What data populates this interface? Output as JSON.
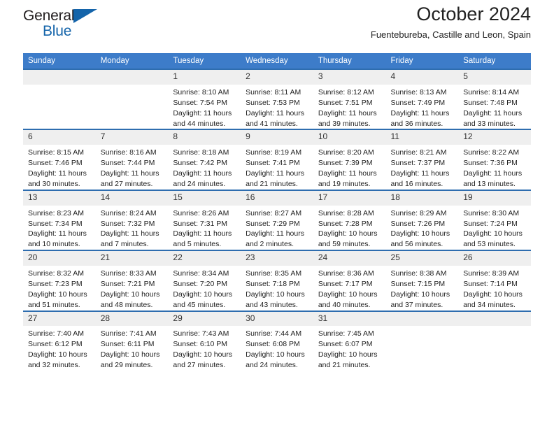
{
  "brand": {
    "name_part1": "General",
    "name_part2": "Blue",
    "accent_color": "#1464aa"
  },
  "header": {
    "title": "October 2024",
    "subtitle": "Fuentebureba, Castille and Leon, Spain"
  },
  "calendar": {
    "header_bg": "#3d7cc9",
    "row_border_color": "#2e6daf",
    "daynum_bg": "#efefef",
    "weekdays": [
      "Sunday",
      "Monday",
      "Tuesday",
      "Wednesday",
      "Thursday",
      "Friday",
      "Saturday"
    ],
    "weeks": [
      [
        {
          "day": "",
          "lines": []
        },
        {
          "day": "",
          "lines": []
        },
        {
          "day": "1",
          "lines": [
            "Sunrise: 8:10 AM",
            "Sunset: 7:54 PM",
            "Daylight: 11 hours and 44 minutes."
          ]
        },
        {
          "day": "2",
          "lines": [
            "Sunrise: 8:11 AM",
            "Sunset: 7:53 PM",
            "Daylight: 11 hours and 41 minutes."
          ]
        },
        {
          "day": "3",
          "lines": [
            "Sunrise: 8:12 AM",
            "Sunset: 7:51 PM",
            "Daylight: 11 hours and 39 minutes."
          ]
        },
        {
          "day": "4",
          "lines": [
            "Sunrise: 8:13 AM",
            "Sunset: 7:49 PM",
            "Daylight: 11 hours and 36 minutes."
          ]
        },
        {
          "day": "5",
          "lines": [
            "Sunrise: 8:14 AM",
            "Sunset: 7:48 PM",
            "Daylight: 11 hours and 33 minutes."
          ]
        }
      ],
      [
        {
          "day": "6",
          "lines": [
            "Sunrise: 8:15 AM",
            "Sunset: 7:46 PM",
            "Daylight: 11 hours and 30 minutes."
          ]
        },
        {
          "day": "7",
          "lines": [
            "Sunrise: 8:16 AM",
            "Sunset: 7:44 PM",
            "Daylight: 11 hours and 27 minutes."
          ]
        },
        {
          "day": "8",
          "lines": [
            "Sunrise: 8:18 AM",
            "Sunset: 7:42 PM",
            "Daylight: 11 hours and 24 minutes."
          ]
        },
        {
          "day": "9",
          "lines": [
            "Sunrise: 8:19 AM",
            "Sunset: 7:41 PM",
            "Daylight: 11 hours and 21 minutes."
          ]
        },
        {
          "day": "10",
          "lines": [
            "Sunrise: 8:20 AM",
            "Sunset: 7:39 PM",
            "Daylight: 11 hours and 19 minutes."
          ]
        },
        {
          "day": "11",
          "lines": [
            "Sunrise: 8:21 AM",
            "Sunset: 7:37 PM",
            "Daylight: 11 hours and 16 minutes."
          ]
        },
        {
          "day": "12",
          "lines": [
            "Sunrise: 8:22 AM",
            "Sunset: 7:36 PM",
            "Daylight: 11 hours and 13 minutes."
          ]
        }
      ],
      [
        {
          "day": "13",
          "lines": [
            "Sunrise: 8:23 AM",
            "Sunset: 7:34 PM",
            "Daylight: 11 hours and 10 minutes."
          ]
        },
        {
          "day": "14",
          "lines": [
            "Sunrise: 8:24 AM",
            "Sunset: 7:32 PM",
            "Daylight: 11 hours and 7 minutes."
          ]
        },
        {
          "day": "15",
          "lines": [
            "Sunrise: 8:26 AM",
            "Sunset: 7:31 PM",
            "Daylight: 11 hours and 5 minutes."
          ]
        },
        {
          "day": "16",
          "lines": [
            "Sunrise: 8:27 AM",
            "Sunset: 7:29 PM",
            "Daylight: 11 hours and 2 minutes."
          ]
        },
        {
          "day": "17",
          "lines": [
            "Sunrise: 8:28 AM",
            "Sunset: 7:28 PM",
            "Daylight: 10 hours and 59 minutes."
          ]
        },
        {
          "day": "18",
          "lines": [
            "Sunrise: 8:29 AM",
            "Sunset: 7:26 PM",
            "Daylight: 10 hours and 56 minutes."
          ]
        },
        {
          "day": "19",
          "lines": [
            "Sunrise: 8:30 AM",
            "Sunset: 7:24 PM",
            "Daylight: 10 hours and 53 minutes."
          ]
        }
      ],
      [
        {
          "day": "20",
          "lines": [
            "Sunrise: 8:32 AM",
            "Sunset: 7:23 PM",
            "Daylight: 10 hours and 51 minutes."
          ]
        },
        {
          "day": "21",
          "lines": [
            "Sunrise: 8:33 AM",
            "Sunset: 7:21 PM",
            "Daylight: 10 hours and 48 minutes."
          ]
        },
        {
          "day": "22",
          "lines": [
            "Sunrise: 8:34 AM",
            "Sunset: 7:20 PM",
            "Daylight: 10 hours and 45 minutes."
          ]
        },
        {
          "day": "23",
          "lines": [
            "Sunrise: 8:35 AM",
            "Sunset: 7:18 PM",
            "Daylight: 10 hours and 43 minutes."
          ]
        },
        {
          "day": "24",
          "lines": [
            "Sunrise: 8:36 AM",
            "Sunset: 7:17 PM",
            "Daylight: 10 hours and 40 minutes."
          ]
        },
        {
          "day": "25",
          "lines": [
            "Sunrise: 8:38 AM",
            "Sunset: 7:15 PM",
            "Daylight: 10 hours and 37 minutes."
          ]
        },
        {
          "day": "26",
          "lines": [
            "Sunrise: 8:39 AM",
            "Sunset: 7:14 PM",
            "Daylight: 10 hours and 34 minutes."
          ]
        }
      ],
      [
        {
          "day": "27",
          "lines": [
            "Sunrise: 7:40 AM",
            "Sunset: 6:12 PM",
            "Daylight: 10 hours and 32 minutes."
          ]
        },
        {
          "day": "28",
          "lines": [
            "Sunrise: 7:41 AM",
            "Sunset: 6:11 PM",
            "Daylight: 10 hours and 29 minutes."
          ]
        },
        {
          "day": "29",
          "lines": [
            "Sunrise: 7:43 AM",
            "Sunset: 6:10 PM",
            "Daylight: 10 hours and 27 minutes."
          ]
        },
        {
          "day": "30",
          "lines": [
            "Sunrise: 7:44 AM",
            "Sunset: 6:08 PM",
            "Daylight: 10 hours and 24 minutes."
          ]
        },
        {
          "day": "31",
          "lines": [
            "Sunrise: 7:45 AM",
            "Sunset: 6:07 PM",
            "Daylight: 10 hours and 21 minutes."
          ]
        },
        {
          "day": "",
          "lines": []
        },
        {
          "day": "",
          "lines": []
        }
      ]
    ]
  }
}
